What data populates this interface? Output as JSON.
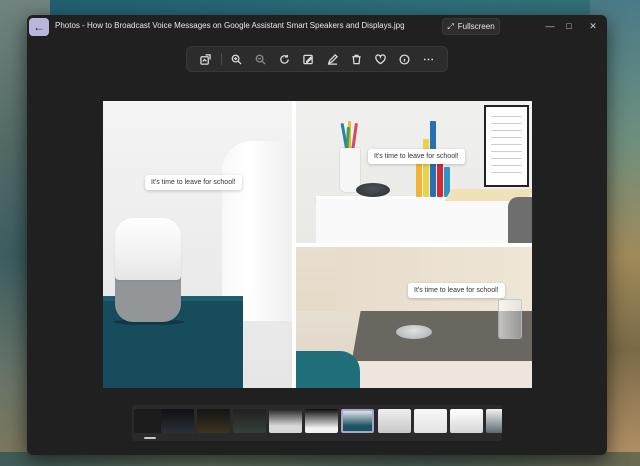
{
  "window": {
    "title": "Photos - How to Broadcast Voice Messages on Google Assistant Smart Speakers and Displays.jpg",
    "fullscreen_label": "Fullscreen",
    "back_icon": "back-arrow-icon",
    "controls": [
      "minimize-icon",
      "maximize-icon",
      "close-icon"
    ]
  },
  "toolbar": {
    "buttons": [
      "edit-image-icon",
      "zoom-in-icon",
      "zoom-out-icon",
      "rotate-icon",
      "edit-icon",
      "draw-icon",
      "delete-icon",
      "favorite-icon",
      "info-icon",
      "more-options-icon"
    ]
  },
  "photo": {
    "captions": [
      "It's time to leave for school!",
      "It's time to leave for school!",
      "It's time to leave for school!"
    ]
  },
  "filmstrip": {
    "thumbnail_count": 11,
    "selected_index": 6
  },
  "colors": {
    "window_bg": "#202020",
    "accent": "#b9b6dc",
    "nightstand": "#174c5c"
  }
}
